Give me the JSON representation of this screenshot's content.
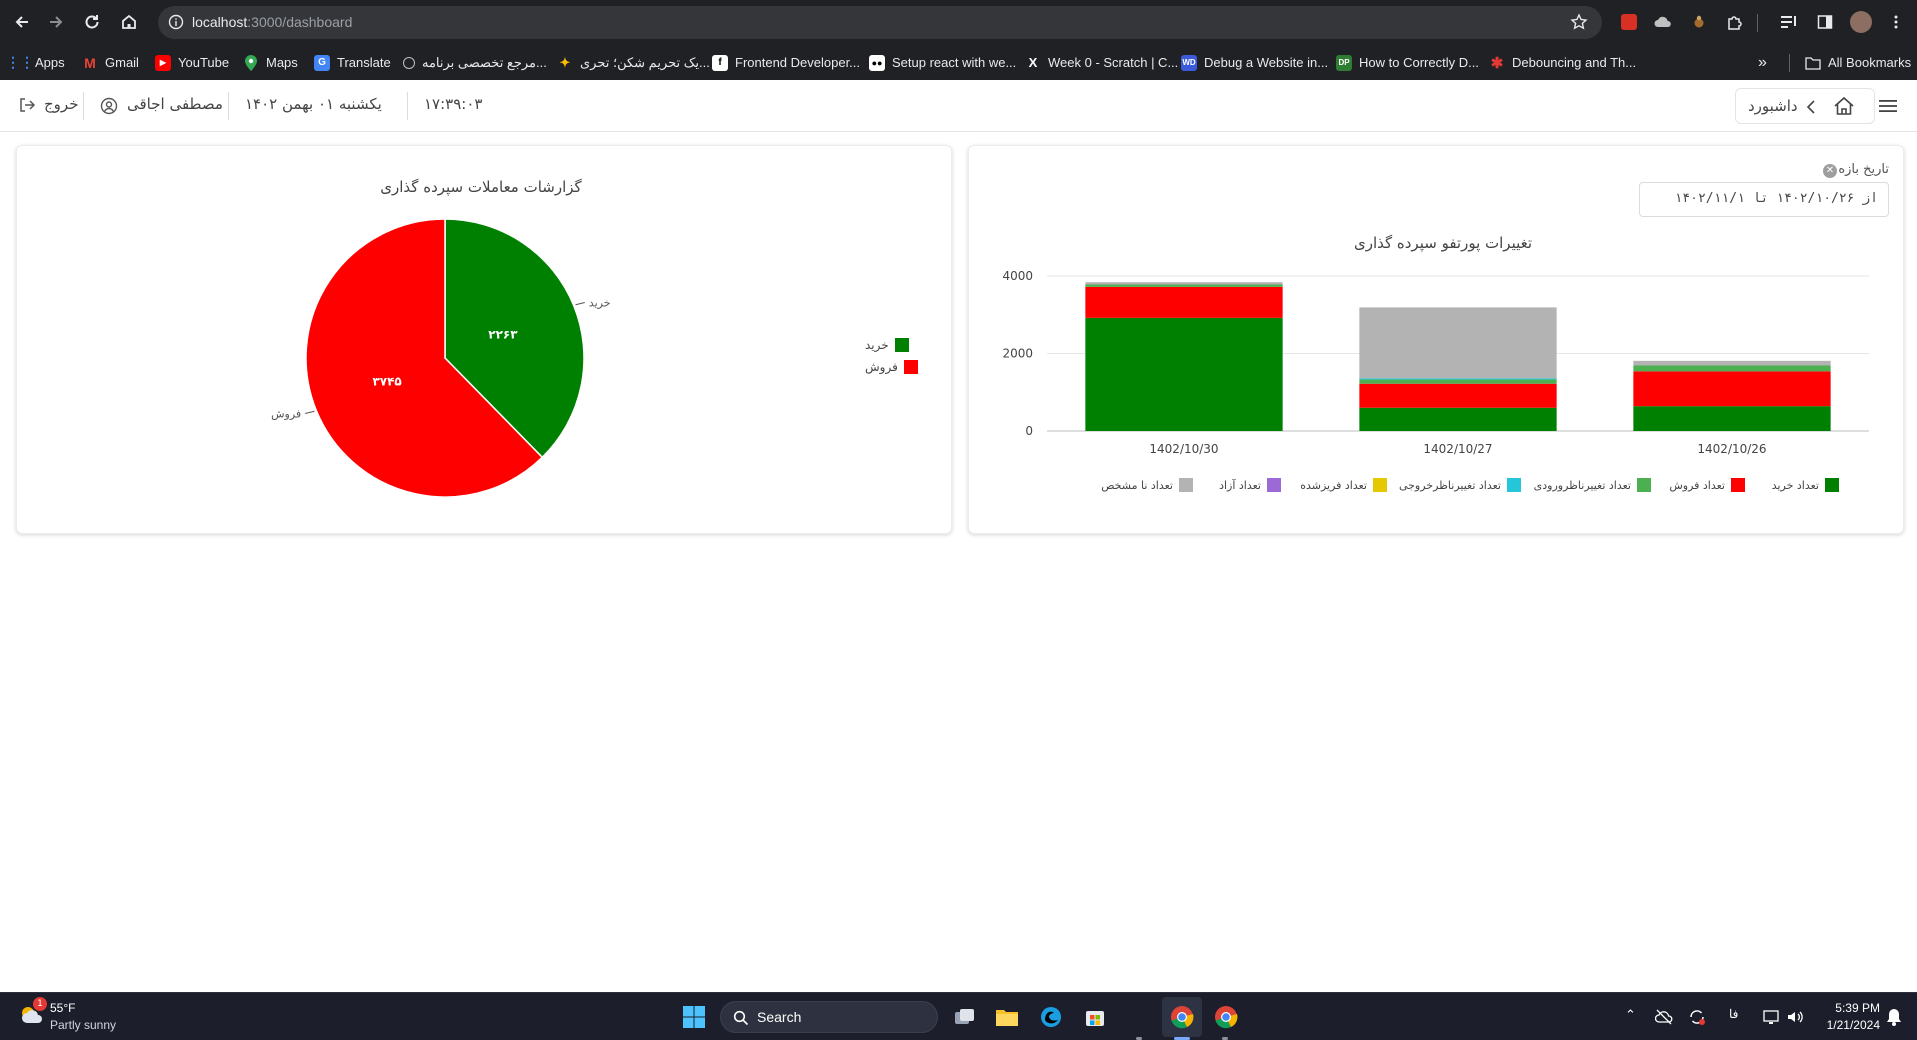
{
  "browser": {
    "url_host": "localhost",
    "url_path": ":3000/dashboard",
    "bookmarks": [
      {
        "label": "Apps",
        "icon": "apps-grid-icon",
        "color": "#4285f4"
      },
      {
        "label": "Gmail",
        "icon": "gmail-icon",
        "color": "#ea4335"
      },
      {
        "label": "YouTube",
        "icon": "youtube-icon",
        "color": "#ff0000"
      },
      {
        "label": "Maps",
        "icon": "maps-pin-icon",
        "color": "#34a853"
      },
      {
        "label": "Translate",
        "icon": "translate-icon",
        "color": "#4285f4"
      },
      {
        "label": "مرجع تخصصی برنامه...",
        "icon": "site-icon",
        "color": "#5f6368"
      },
      {
        "label": "یک تحریم شکن؛ تحری...",
        "icon": "site-icon",
        "color": "#fbbc04"
      },
      {
        "label": "Frontend Developer...",
        "icon": "site-icon",
        "color": "#000000"
      },
      {
        "label": "Setup react with we...",
        "icon": "medium-icon",
        "color": "#000000"
      },
      {
        "label": "Week 0 - Scratch | C...",
        "icon": "x-icon",
        "color": "#000000"
      },
      {
        "label": "Debug a Website in...",
        "icon": "wd-icon",
        "color": "#3b5bdb"
      },
      {
        "label": "How to Correctly D...",
        "icon": "dp-icon",
        "color": "#2e7d32"
      },
      {
        "label": "Debouncing and Th...",
        "icon": "asterisk-icon",
        "color": "#e53935"
      }
    ],
    "all_bookmarks": "All Bookmarks"
  },
  "header": {
    "logout": "خروج",
    "user_name": "مصطفی اجاقی",
    "date": "یکشنبه ۰۱ بهمن ۱۴۰۲",
    "time": "۱۷:۳۹:۰۳",
    "breadcrumb": "داشبورد"
  },
  "portfolio_card": {
    "range_label": "تاریخ بازه",
    "range_value": "از ۱۴۰۲/۱۰/۲۶  تا ۱۴۰۲/۱۱/۱",
    "chart_data": {
      "type": "bar",
      "stacked": true,
      "title": "تغییرات پورتفو سپرده گذاری",
      "categories": [
        "1402/10/30",
        "1402/10/27",
        "1402/10/26"
      ],
      "ylim": [
        0,
        4000
      ],
      "yticks": [
        "0",
        "2000",
        "4000"
      ],
      "grid": true,
      "legend_position": "bottom",
      "series": [
        {
          "name": "تعداد خرید",
          "color": "#008000",
          "values": [
            2920,
            600,
            640
          ]
        },
        {
          "name": "تعداد فروش",
          "color": "#ff0000",
          "values": [
            800,
            620,
            900
          ]
        },
        {
          "name": "تعداد تغییرناظرورودی",
          "color": "#4caf50",
          "values": [
            60,
            110,
            150
          ]
        },
        {
          "name": "تعداد تغییرناظرخروجی",
          "color": "#26c6da",
          "values": [
            0,
            30,
            0
          ]
        },
        {
          "name": "تعداد فریزشده",
          "color": "#e6c800",
          "values": [
            0,
            0,
            0
          ]
        },
        {
          "name": "تعداد آزاد",
          "color": "#9c6ad6",
          "values": [
            0,
            0,
            0
          ]
        },
        {
          "name": "تعداد نا مشخص",
          "color": "#b3b3b3",
          "values": [
            60,
            1830,
            120
          ]
        }
      ]
    }
  },
  "deals_card": {
    "chart_data": {
      "type": "pie",
      "title": "گزارشات معاملات سپرده گذاری",
      "legend_position": "right",
      "slices": [
        {
          "name": "خرید",
          "value": 2263,
          "value_label": "۲۲۶۳",
          "color": "#008000"
        },
        {
          "name": "فروش",
          "value": 3745,
          "value_label": "۳۷۴۵",
          "color": "#ff0000"
        }
      ]
    }
  },
  "taskbar": {
    "weather_temp": "55°F",
    "weather_desc": "Partly sunny",
    "weather_badge": "1",
    "search_placeholder": "Search",
    "lang": "فا",
    "clock_time": "5:39 PM",
    "clock_date": "1/21/2024"
  }
}
